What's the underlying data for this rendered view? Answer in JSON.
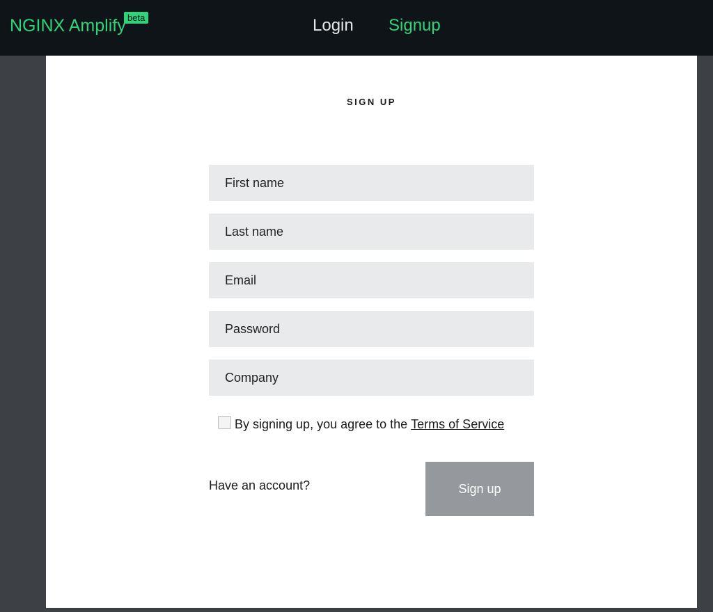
{
  "header": {
    "brand": "NGINX Amplify",
    "badge": "beta",
    "nav": {
      "login": "Login",
      "signup": "Signup"
    }
  },
  "form": {
    "title": "SIGN UP",
    "fields": {
      "first_name": {
        "placeholder": "First name",
        "value": ""
      },
      "last_name": {
        "placeholder": "Last name",
        "value": ""
      },
      "email": {
        "placeholder": "Email",
        "value": ""
      },
      "password": {
        "placeholder": "Password",
        "value": ""
      },
      "company": {
        "placeholder": "Company",
        "value": ""
      }
    },
    "terms": {
      "checked": false,
      "text": "By signing up, you agree to the",
      "link": "Terms of Service"
    },
    "have_account": "Have an account?",
    "submit": "Sign up"
  },
  "colors": {
    "accent": "#2fd47a",
    "topbar": "#0f1418",
    "page_bg": "#3d4145",
    "field_bg": "#e9eaec",
    "button_bg": "#95999d"
  }
}
